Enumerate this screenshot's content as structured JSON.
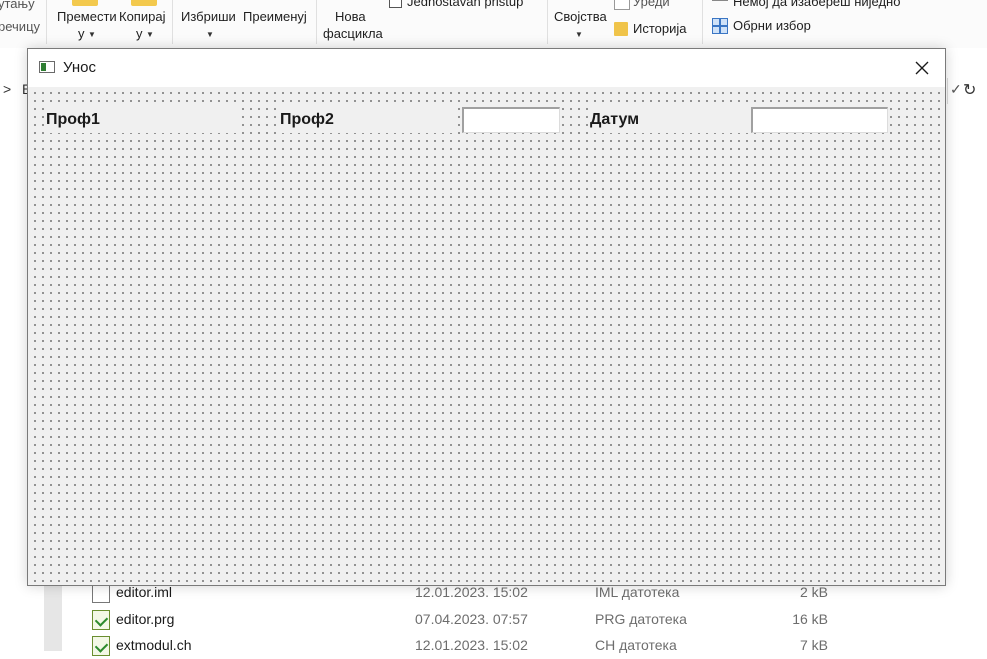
{
  "explorer": {
    "ribbon": {
      "cut_left_label_1": "утању",
      "cut_left_label_2": "речицу",
      "move_label_1": "Премести",
      "move_label_2": "у",
      "copy_label_1": "Копирај",
      "copy_label_2": "у",
      "delete_label": "Избриши",
      "rename_label": "Преименуј",
      "new_folder_label_1": "Нова",
      "new_folder_label_2": "фасцикла",
      "easy_access_label": "Jednostavan pristup",
      "properties_label": "Својства",
      "edit_label": "Уреди",
      "history_label": "Историја",
      "select_none_label": "Немој да изабереш ниједно",
      "invert_selection_label": "Обрни избор"
    },
    "address_left_glyph": ">",
    "address_left_letter": "E",
    "files": [
      {
        "name": "editor.iml",
        "date": "12.01.2023. 15:02",
        "type": "IML датотека",
        "size": "2 kB",
        "icon": "blank-file-icon"
      },
      {
        "name": "editor.prg",
        "date": "07.04.2023. 07:57",
        "type": "PRG датотека",
        "size": "16 kB",
        "icon": "script-file-icon"
      },
      {
        "name": "extmodul.ch",
        "date": "12.01.2023. 15:02",
        "type": "CH датотека",
        "size": "7 kB",
        "icon": "script-file-icon"
      }
    ]
  },
  "dialog": {
    "title": "Унос",
    "close_icon": "close-icon",
    "labels": {
      "prof1": "Проф1",
      "prof2": "Проф2",
      "datum": "Датум"
    },
    "fields": {
      "prof2_value": "",
      "datum_value": ""
    }
  },
  "colors": {
    "dialog_client_bg": "#f0f0f0",
    "grid_dot": "#6e6e6e",
    "title_bar_bg": "#ffffff"
  }
}
